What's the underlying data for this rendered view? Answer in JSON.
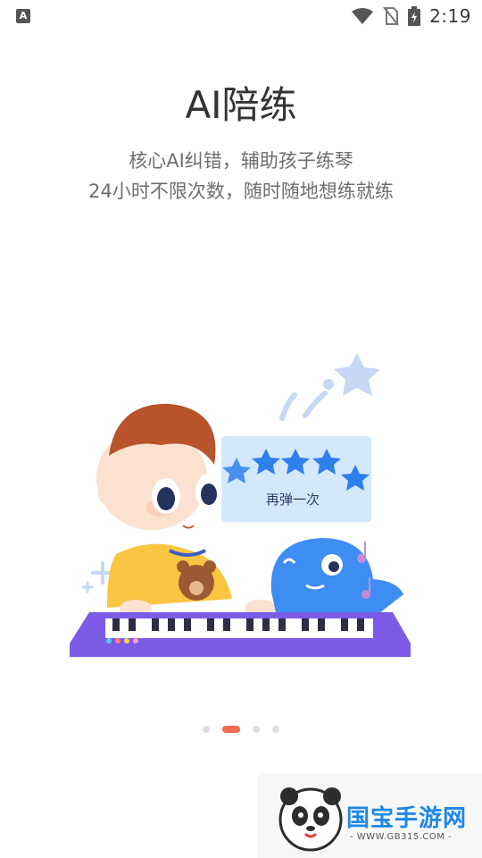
{
  "status_bar": {
    "app_icon_letter": "A",
    "time": "2:19",
    "icons": [
      "wifi-icon",
      "no-sim-icon",
      "battery-charging-icon"
    ]
  },
  "onboarding": {
    "title": "AI陪练",
    "subtitle_line1": "核心AI纠错，辅助孩子练琴",
    "subtitle_line2": "24小时不限次数，随时随地想练就练",
    "illustration_bubble_text": "再弹一次",
    "illustration_star_rating": 4,
    "page_count": 4,
    "current_page": 2,
    "accent_color": "#f26a4f",
    "keyboard_color": "#7b5be6"
  },
  "watermark": {
    "name": "国宝手游网",
    "url": "- WWW.GB315.COM -"
  }
}
